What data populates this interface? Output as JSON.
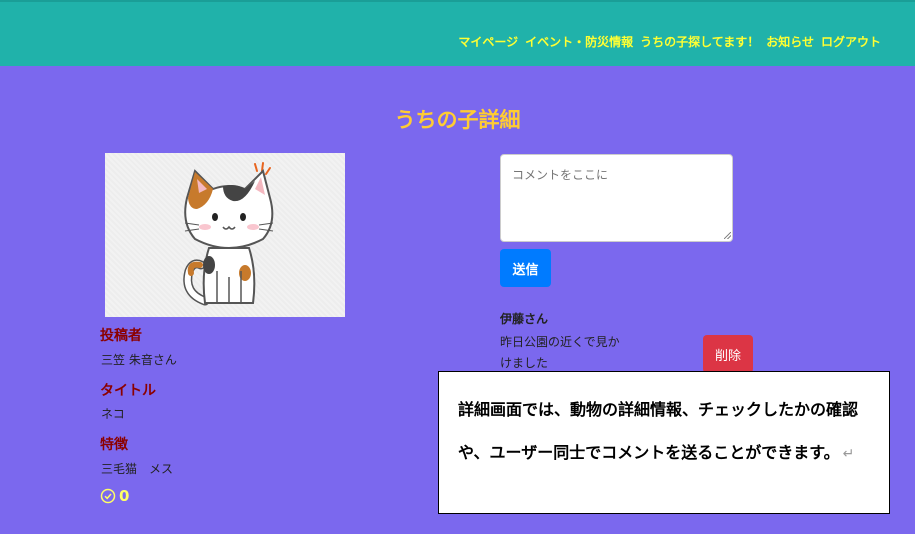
{
  "nav": {
    "items": [
      "マイページ",
      "イベント・防災情報",
      "うちの子探してます！",
      "お知らせ",
      "ログアウト"
    ]
  },
  "page": {
    "title": "うちの子詳細"
  },
  "pet": {
    "image_icon": "calico-cat-illustration",
    "poster_label": "投稿者",
    "poster_value": "三笠 朱音さん",
    "title_label": "タイトル",
    "title_value": "ネコ",
    "feature_label": "特徴",
    "feature_value": "三毛猫　メス",
    "check_icon": "check-circle-icon",
    "check_count": "0"
  },
  "comment_form": {
    "placeholder": "コメントをここに",
    "submit_label": "送信"
  },
  "comments": [
    {
      "author": "伊藤さん",
      "text": "昨日公園の近くで見かけました",
      "delete_label": "削除"
    }
  ],
  "callout": {
    "text": "詳細画面では、動物の詳細情報、チェックしたかの確認や、ユーザー同士でコメントを送ることができます。",
    "mark": "↵"
  },
  "colors": {
    "nav_bg": "#20b2aa",
    "nav_text": "#ffff33",
    "page_bg": "#7b68ee",
    "title": "#ffcc33",
    "label": "#8b0000",
    "send": "#007bff",
    "delete": "#dc3545"
  }
}
